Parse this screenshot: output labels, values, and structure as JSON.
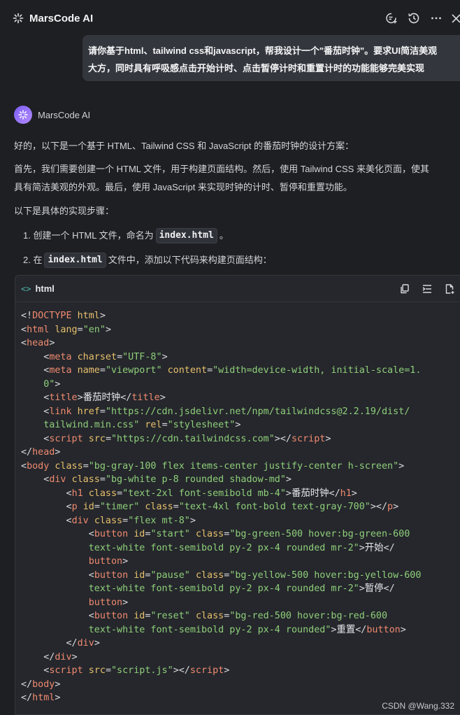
{
  "header": {
    "title": "MarsCode AI",
    "icons": [
      "sparkle-logo-icon",
      "new-chat-icon",
      "history-icon",
      "more-icon",
      "close-icon"
    ]
  },
  "user_message": {
    "line1": "请你基于html、tailwind css和javascript，帮我设计一个\"番茄时钟\"。要求UI简洁美观",
    "line2": "大方，同时具有呼吸感点击开始计时、点击暂停计时和重置计时的功能能够完美实现"
  },
  "assistant": {
    "name": "MarsCode AI",
    "intro": "好的，以下是一个基于 HTML、Tailwind CSS 和 JavaScript 的番茄时钟的设计方案：",
    "para2_line1": "首先，我们需要创建一个 HTML 文件，用于构建页面结构。然后，使用 Tailwind CSS 来美化页面，使其",
    "para2_line2": "具有简洁美观的外观。最后，使用 JavaScript 来实现时钟的计时、暂停和重置功能。",
    "steps_intro": "以下是具体的实现步骤：",
    "step1": {
      "prefix": "1. 创建一个 HTML 文件，命名为",
      "code": "index.html",
      "suffix": "。"
    },
    "step2": {
      "prefix": "2. 在",
      "code": "index.html",
      "suffix": "文件中，添加以下代码来构建页面结构："
    }
  },
  "code_block": {
    "language_icon": "<>",
    "language": "html",
    "actions": [
      "copy-icon",
      "insert-icon",
      "apply-file-icon"
    ]
  },
  "watermark": "CSDN @Wang.332"
}
